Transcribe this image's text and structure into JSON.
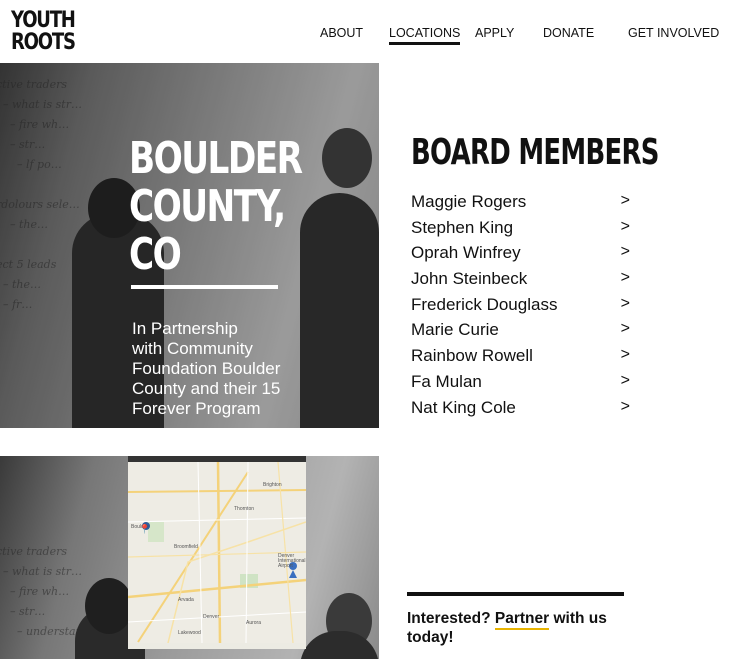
{
  "brand": {
    "line1": "YOUTH",
    "line2": "ROOTS"
  },
  "nav": {
    "items": [
      {
        "label": "ABOUT"
      },
      {
        "label": "LOCATIONS"
      },
      {
        "label": "APPLY"
      },
      {
        "label": "DONATE"
      },
      {
        "label": "GET INVOLVED"
      }
    ],
    "active": "LOCATIONS"
  },
  "hero": {
    "title_lines": [
      "BOULDER",
      "COUNTY,",
      "CO"
    ],
    "subtitle_lines": [
      "In Partnership",
      "with Community",
      "Foundation Boulder",
      "County and their 15",
      "Forever Program"
    ]
  },
  "board": {
    "title": "BOARD MEMBERS",
    "arrow_glyph": ">",
    "members": [
      "Maggie Rogers",
      "Stephen King",
      "Oprah Winfrey",
      "John Steinbeck",
      "Frederick Douglass",
      "Marie Curie",
      "Rainbow Rowell",
      "Fa Mulan",
      "Nat King Cole"
    ]
  },
  "map": {
    "labels": [
      "Boulder",
      "Broomfield",
      "Thornton",
      "Denver",
      "Aurora",
      "Arvada",
      "Lakewood",
      "Brighton",
      "Denver International Airport"
    ]
  },
  "cta": {
    "prefix": "Interested?",
    "link": "Partner",
    "suffix": "with us",
    "line2": "today!"
  },
  "colors": {
    "accent_underline": "#e8b400",
    "text": "#111111",
    "hero_text": "#ffffff"
  }
}
